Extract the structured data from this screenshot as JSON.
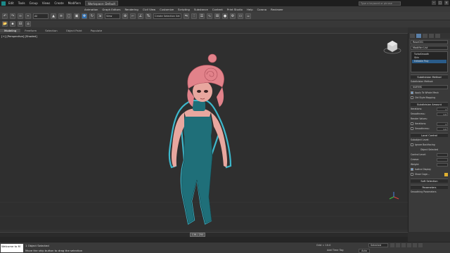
{
  "titlebar": {
    "menus": [
      "Edit",
      "Tools",
      "Group",
      "Views",
      "Create",
      "Modifiers"
    ],
    "workspace": "Workspace: Default",
    "search_placeholder": "Type a keyword or phrase"
  },
  "menubar": {
    "items": [
      "Animation",
      "Graph Editors",
      "Rendering",
      "Civil View",
      "Customize",
      "Scripting",
      "Substance",
      "Content",
      "Print Studio",
      "Help",
      "Corona",
      "Reviewer"
    ]
  },
  "toolbar": {
    "drop1": "All",
    "drop2": "View",
    "drop3": "Create Selection Set"
  },
  "ribbon": {
    "tabs": [
      "Modeling",
      "Freeform",
      "Selection",
      "Object Paint",
      "Populate"
    ],
    "active": "Modeling"
  },
  "viewport": {
    "label": "[+] [Perspective] [Shaded]"
  },
  "cmdpanel": {
    "object_name": "Rose001",
    "modifier_list": "Modifier List",
    "stack": [
      "TurboSmooth",
      "Skin",
      "Editable Poly"
    ],
    "rollout_subdivision_method": "Subdivision Method",
    "subdivision_method_label": "Subdivision Method:",
    "subdivision_method_value": "NURMS",
    "apply_whole_mesh": "Apply To Whole Mesh",
    "old_style_mapping": "Old Style Mapping",
    "rollout_subdivision_amount": "Subdivision Amount",
    "iterations_label": "Iterations:",
    "iterations_value": "1",
    "smoothness_label": "Smoothness:",
    "smoothness_value": "1.0",
    "render_values": "Render Values:",
    "render_iterations_label": "Iterations:",
    "render_iterations_value": "1",
    "render_smoothness_label": "Smoothness:",
    "render_smoothness_value": "1.0",
    "rollout_local_control": "Local Control",
    "subobject_level": "Subobject Level:",
    "ignore_backfacing": "Ignore Backfacing",
    "object_selected": "Object Selected",
    "control_level_label": "Control Level:",
    "crease_label": "Crease:",
    "weight_label": "Weight:",
    "isoline_display": "Isoline Display",
    "show_cage": "Show Cage...",
    "rollout_soft_selection": "Soft Selection",
    "rollout_parameters": "Parameters",
    "smoothing_parameters": "Smoothing Parameters"
  },
  "timeslider": {
    "frame": "136 / 250"
  },
  "statusbar": {
    "maxscript": "Welcome to M",
    "status_line1": "1 Object Selected",
    "status_line2": "Move the ship button to drag the selection",
    "coords": "X: 0   Y: 0   Z: 0",
    "grid": "Grid = 10.0",
    "add_time_tag": "Add Time Tag",
    "auto_key": "Auto Key",
    "selected": "Selected",
    "set_key": "Set Key",
    "key_filters": "Key Filters..."
  },
  "colors": {
    "character_skin": "#e8a79f",
    "character_hair": "#e2828a",
    "character_dress": "#1f6f79",
    "selection_glow": "#3fd0e8"
  }
}
